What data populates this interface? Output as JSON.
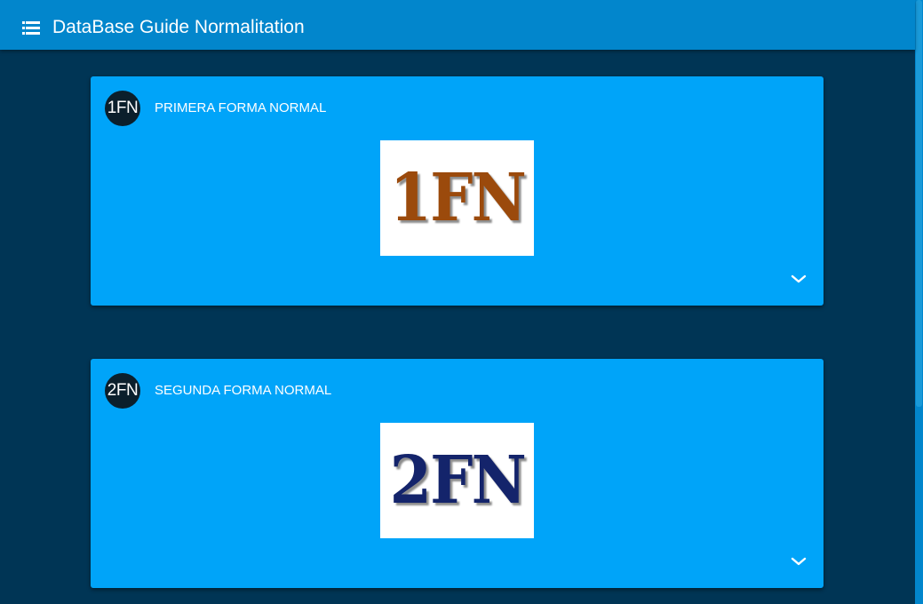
{
  "appbar": {
    "title": "DataBase Guide Normalitation",
    "menu_icon": "list-icon"
  },
  "cards": [
    {
      "avatar": "1FN",
      "title": "PRIMERA FORMA NORMAL",
      "image_text": "1FN",
      "image_color": "#9b4a0c",
      "expand_icon": "chevron-down-icon"
    },
    {
      "avatar": "2FN",
      "title": "SEGUNDA FORMA NORMAL",
      "image_text": "2FN",
      "image_color": "#14246b",
      "expand_icon": "chevron-down-icon"
    }
  ],
  "colors": {
    "background": "#003555",
    "appbar": "#0286cc",
    "card": "#00a4f9",
    "avatar": "#0b1f2c"
  }
}
